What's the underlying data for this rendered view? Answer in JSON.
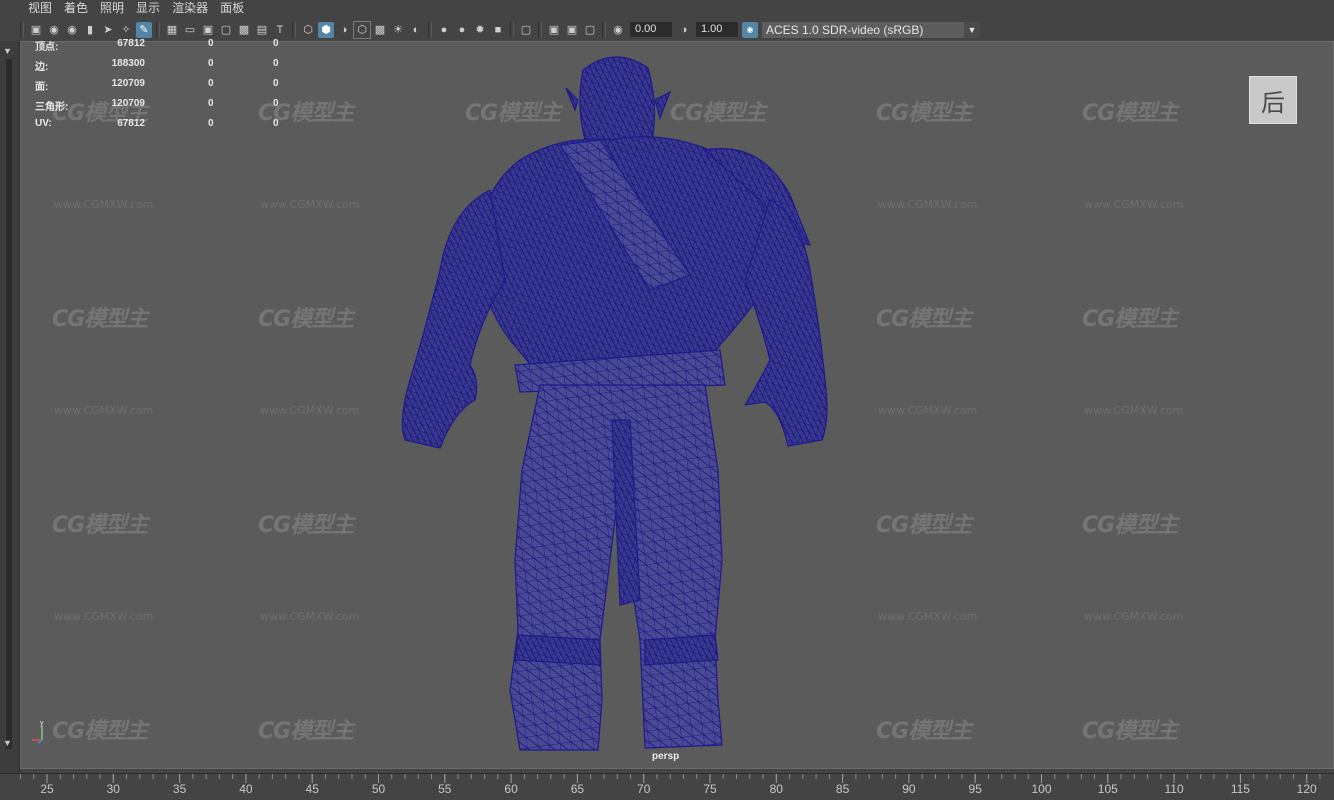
{
  "menu": [
    "视图",
    "着色",
    "照明",
    "显示",
    "渲染器",
    "面板"
  ],
  "toolbar": {
    "exposure_value": "0.00",
    "gamma_value": "1.00",
    "color_space": "ACES 1.0 SDR-video (sRGB)"
  },
  "hud": {
    "rows": [
      {
        "label": "顶点:",
        "v1": "67812",
        "v2": "0",
        "v3": "0"
      },
      {
        "label": "边:",
        "v1": "188300",
        "v2": "0",
        "v3": "0"
      },
      {
        "label": "面:",
        "v1": "120709",
        "v2": "0",
        "v3": "0"
      },
      {
        "label": "三角形:",
        "v1": "120709",
        "v2": "0",
        "v3": "0"
      },
      {
        "label": "UV:",
        "v1": "67812",
        "v2": "0",
        "v3": "0"
      }
    ]
  },
  "view_cube_label": "后",
  "camera_label": "persp",
  "axis": {
    "y": "y",
    "x": "x",
    "z": "z"
  },
  "timeline_ticks": [
    "25",
    "30",
    "35",
    "40",
    "45",
    "50",
    "55",
    "60",
    "65",
    "70",
    "75",
    "80",
    "85",
    "90",
    "95",
    "100",
    "105",
    "110",
    "115",
    "120"
  ],
  "watermark": {
    "logo": "CG模型主",
    "url": "www.CGMXW.com"
  },
  "colors": {
    "viewport_bg": "#5b5b5b",
    "wireframe": "#1c1a8c",
    "accent": "#5285a6"
  }
}
